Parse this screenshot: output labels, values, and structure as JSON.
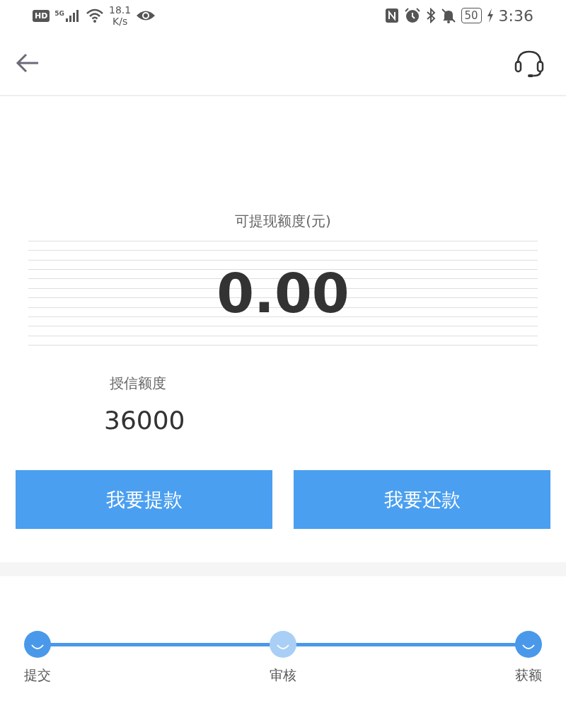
{
  "status_bar": {
    "hd": "HD",
    "network": "5G",
    "speed_value": "18.1",
    "speed_unit": "K/s",
    "battery": "50",
    "time": "3:36"
  },
  "balance": {
    "label": "可提现额度(元)",
    "amount": "0.00"
  },
  "credit": {
    "label": "授信额度",
    "amount": "36000"
  },
  "buttons": [
    {
      "label": "我要提款"
    },
    {
      "label": "我要还款"
    }
  ],
  "steps": [
    {
      "label": "提交",
      "active": true
    },
    {
      "label": "审核",
      "active": false
    },
    {
      "label": "获额",
      "active": true
    }
  ]
}
